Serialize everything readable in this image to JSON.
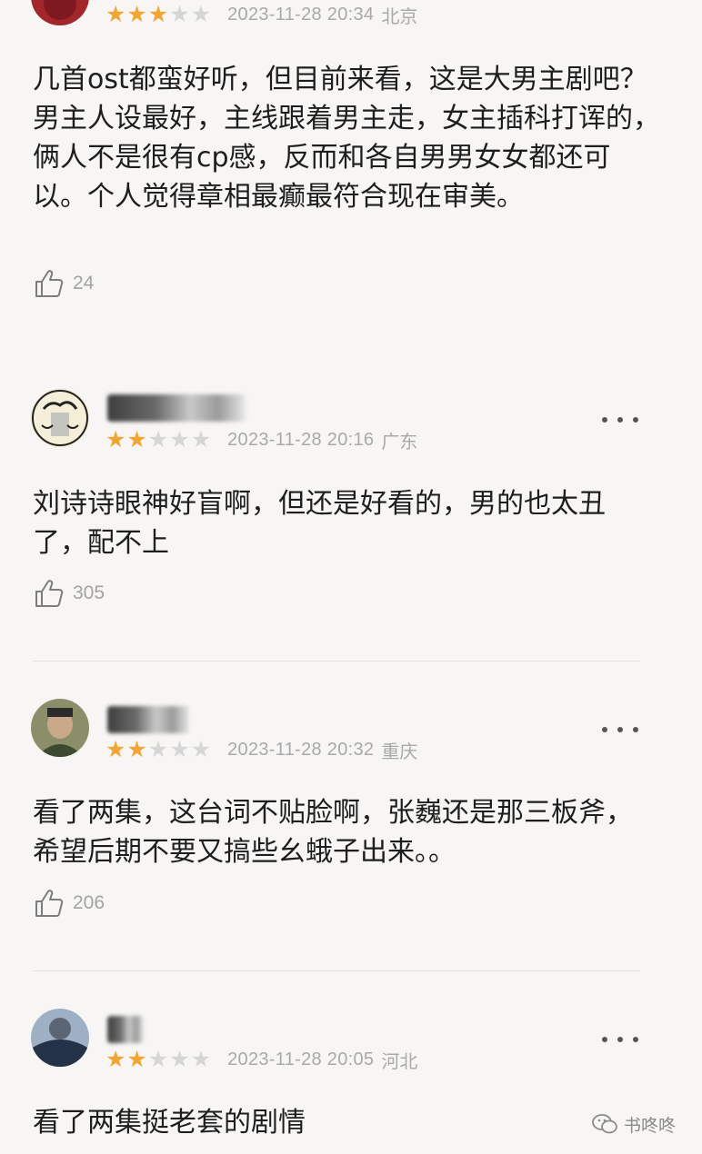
{
  "comments": [
    {
      "rating": 3,
      "date": "2023-11-28 20:34",
      "location": "北京",
      "text": "几首ost都蛮好听，但目前来看，这是大男主剧吧？男主人设最好，主线跟着男主走，女主插科打诨的，俩人不是很有cp感，反而和各自男男女女都还可以。个人觉得章相最癫最符合现在审美。",
      "likes": "24"
    },
    {
      "rating": 2,
      "date": "2023-11-28 20:16",
      "location": "广东",
      "text": "刘诗诗眼神好盲啊，但还是好看的，男的也太丑了，配不上",
      "likes": "305"
    },
    {
      "rating": 2,
      "date": "2023-11-28 20:32",
      "location": "重庆",
      "text": "看了两集，这台词不贴脸啊，张巍还是那三板斧，希望后期不要又搞些幺蛾子出来。。",
      "likes": "206"
    },
    {
      "rating": 2,
      "date": "2023-11-28 20:05",
      "location": "河北",
      "text": "看了两集挺老套的剧情",
      "likes": ""
    }
  ],
  "watermark": "书咚咚",
  "colors": {
    "star_on": "#f2a533",
    "star_off": "#d6d6d6",
    "meta": "#a9a9a9"
  },
  "icons": {
    "like": "thumbs-up-icon",
    "more": "more-dots-icon",
    "watermark": "wechat-icon"
  }
}
